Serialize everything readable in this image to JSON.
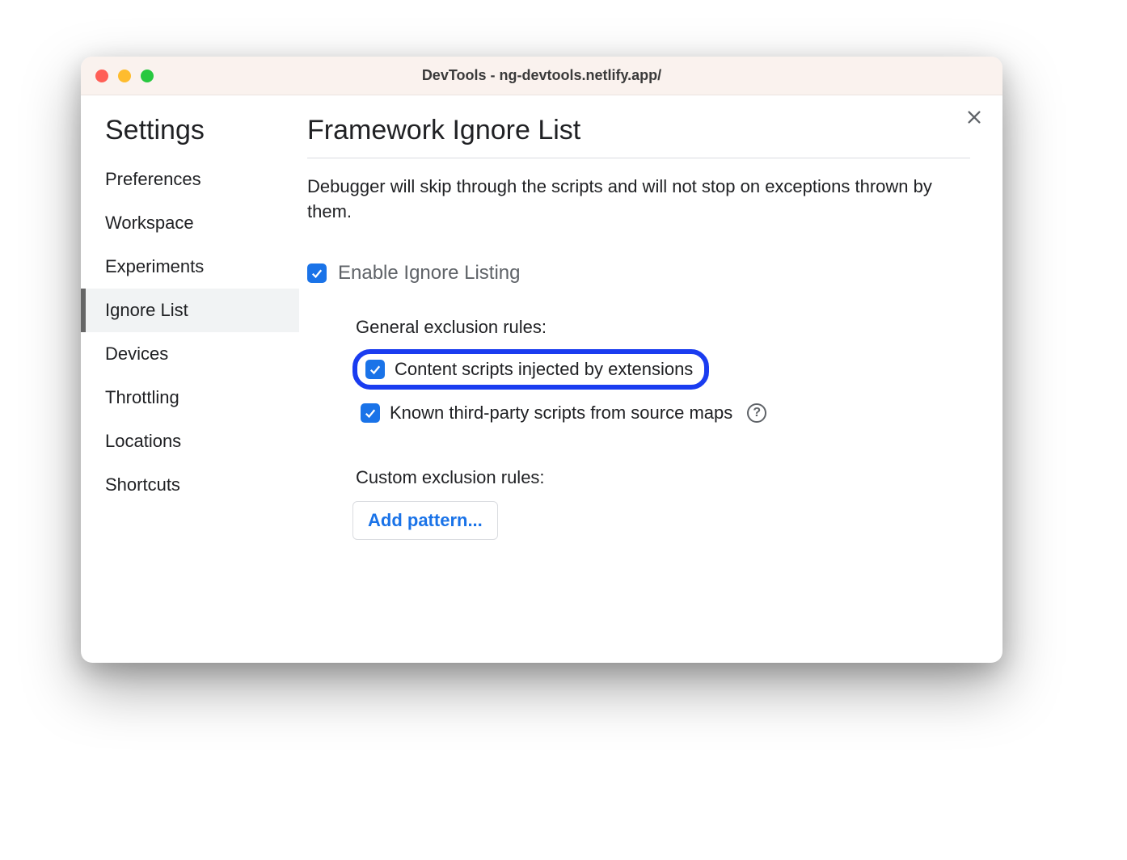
{
  "window": {
    "title": "DevTools - ng-devtools.netlify.app/"
  },
  "sidebar": {
    "heading": "Settings",
    "items": [
      {
        "label": "Preferences"
      },
      {
        "label": "Workspace"
      },
      {
        "label": "Experiments"
      },
      {
        "label": "Ignore List",
        "selected": true
      },
      {
        "label": "Devices"
      },
      {
        "label": "Throttling"
      },
      {
        "label": "Locations"
      },
      {
        "label": "Shortcuts"
      }
    ]
  },
  "main": {
    "title": "Framework Ignore List",
    "description": "Debugger will skip through the scripts and will not stop on exceptions thrown by them.",
    "enable_label": "Enable Ignore Listing",
    "general_heading": "General exclusion rules:",
    "general_rules": [
      {
        "label": "Content scripts injected by extensions",
        "checked": true,
        "highlighted": true
      },
      {
        "label": "Known third-party scripts from source maps",
        "checked": true,
        "help": true
      }
    ],
    "custom_heading": "Custom exclusion rules:",
    "add_pattern_label": "Add pattern..."
  }
}
